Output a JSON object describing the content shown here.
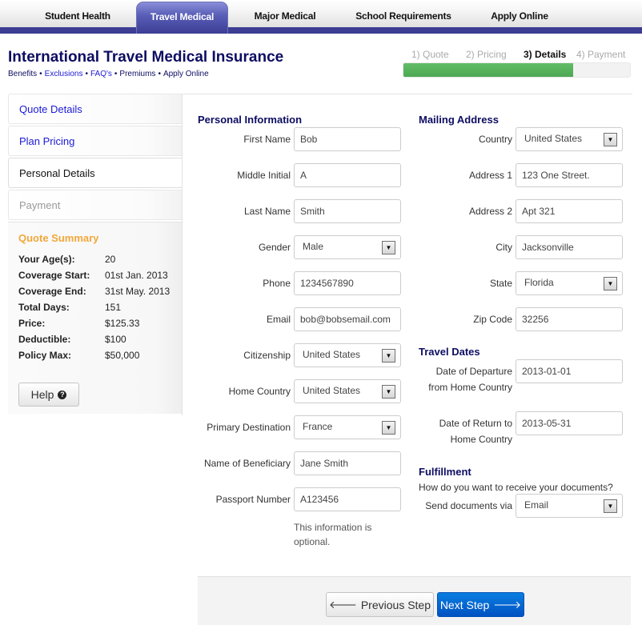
{
  "topnav": {
    "tabs": [
      {
        "label": "Student Health",
        "active": false
      },
      {
        "label": "Travel Medical",
        "active": true
      },
      {
        "label": "Major Medical",
        "active": false
      },
      {
        "label": "School Requirements",
        "active": false
      },
      {
        "label": "Apply Online",
        "active": false
      }
    ]
  },
  "header": {
    "title": "International Travel Medical Insurance",
    "links": [
      "Benefits",
      "Exclusions",
      "FAQ's",
      "Premiums",
      "Apply Online"
    ],
    "separator": "•"
  },
  "progress": {
    "steps": [
      "1) Quote",
      "2) Pricing",
      "3) Details",
      "4) Payment"
    ],
    "current_step": 3,
    "percent": 75,
    "color": "#5cb85c"
  },
  "sidebar": {
    "items": [
      {
        "label": "Quote Details",
        "state": "link"
      },
      {
        "label": "Plan Pricing",
        "state": "link"
      },
      {
        "label": "Personal Details",
        "state": "current"
      },
      {
        "label": "Payment",
        "state": "disabled"
      }
    ],
    "summary": {
      "title": "Quote Summary",
      "rows": [
        {
          "k": "Your Age(s):",
          "v": "20"
        },
        {
          "k": "Coverage Start:",
          "v": "01st Jan. 2013"
        },
        {
          "k": "Coverage End:",
          "v": "31st May. 2013"
        },
        {
          "k": "Total Days:",
          "v": "151"
        },
        {
          "k": "Price:",
          "v": "$125.33"
        },
        {
          "k": "Deductible:",
          "v": "$100"
        },
        {
          "k": "Policy Max:",
          "v": "$50,000"
        }
      ]
    },
    "help_label": "Help",
    "help_icon": "?"
  },
  "personal": {
    "title": "Personal Information",
    "first_name": {
      "label": "First Name",
      "value": "Bob"
    },
    "middle_initial": {
      "label": "Middle Initial",
      "value": "A"
    },
    "last_name": {
      "label": "Last Name",
      "value": "Smith"
    },
    "gender": {
      "label": "Gender",
      "value": "Male"
    },
    "phone": {
      "label": "Phone",
      "value": "1234567890"
    },
    "email": {
      "label": "Email",
      "value": "bob@bobsemail.com"
    },
    "citizenship": {
      "label": "Citizenship",
      "value": "United States"
    },
    "home_country": {
      "label": "Home Country",
      "value": "United States"
    },
    "primary_destination": {
      "label": "Primary Destination",
      "value": "France"
    },
    "beneficiary": {
      "label": "Name of Beneficiary",
      "value": "Jane Smith"
    },
    "passport": {
      "label": "Passport Number",
      "value": "A123456"
    },
    "passport_note_1": "This information is",
    "passport_note_2": "optional."
  },
  "mailing": {
    "title": "Mailing Address",
    "country": {
      "label": "Country",
      "value": "United States"
    },
    "address1": {
      "label": "Address 1",
      "value": "123 One Street."
    },
    "address2": {
      "label": "Address 2",
      "value": "Apt 321"
    },
    "city": {
      "label": "City",
      "value": "Jacksonville"
    },
    "state": {
      "label": "State",
      "value": "Florida"
    },
    "zip": {
      "label": "Zip Code",
      "value": "32256"
    }
  },
  "travel": {
    "title": "Travel Dates",
    "departure": {
      "label_1": "Date of Departure",
      "label_2": "from Home Country",
      "value": "2013-01-01"
    },
    "return": {
      "label_1": "Date of Return to",
      "label_2": "Home Country",
      "value": "2013-05-31"
    }
  },
  "fulfillment": {
    "title": "Fulfillment",
    "question": "How do you want to receive your documents?",
    "send_via": {
      "label": "Send documents via",
      "value": "Email"
    }
  },
  "footer": {
    "prev_label": "Previous Step",
    "next_label": "Next Step",
    "prev_icon": "🡐",
    "next_icon": "🡒"
  }
}
